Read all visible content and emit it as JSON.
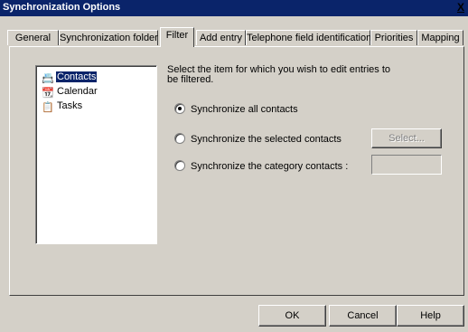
{
  "window": {
    "title": "Synchronization Options",
    "close_label": "X"
  },
  "tabs": [
    {
      "label": "General",
      "active": false
    },
    {
      "label": "Synchronization folder",
      "active": false
    },
    {
      "label": "Filter",
      "active": true
    },
    {
      "label": "Add entry",
      "active": false
    },
    {
      "label": "Telephone field identification",
      "active": false
    },
    {
      "label": "Priorities",
      "active": false
    },
    {
      "label": "Mapping",
      "active": false
    }
  ],
  "filter": {
    "items": [
      {
        "label": "Contacts",
        "icon": "contacts-icon",
        "selected": true
      },
      {
        "label": "Calendar",
        "icon": "calendar-icon",
        "selected": false
      },
      {
        "label": "Tasks",
        "icon": "tasks-icon",
        "selected": false
      }
    ],
    "instruction": "Select the item for which you wish to edit entries to be filtered.",
    "options": [
      {
        "label": "Synchronize all contacts",
        "checked": true
      },
      {
        "label": "Synchronize the selected contacts",
        "checked": false
      },
      {
        "label": "Synchronize the category contacts :",
        "checked": false
      }
    ],
    "select_button": "Select...",
    "category_value": ""
  },
  "buttons": {
    "ok": "OK",
    "cancel": "Cancel",
    "help": "Help"
  },
  "colors": {
    "titlebar": "#0a246a",
    "face": "#d4d0c8",
    "selection": "#0a246a"
  }
}
